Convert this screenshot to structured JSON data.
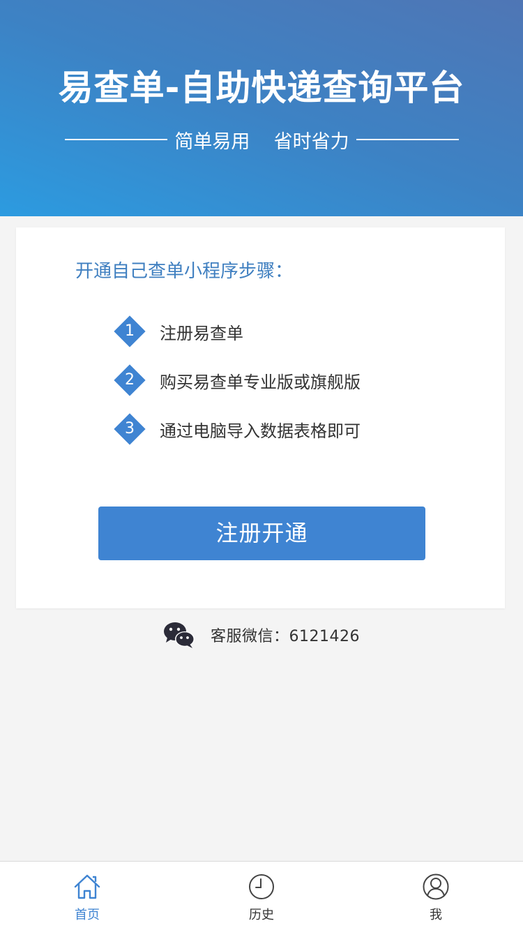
{
  "header": {
    "title": "易查单-自助快递查询平台",
    "subtitle": "简单易用    省时省力"
  },
  "card": {
    "heading": "开通自己查单小程序步骤：",
    "steps": [
      {
        "number": "1",
        "text": "注册易查单"
      },
      {
        "number": "2",
        "text": "购买易查单专业版或旗舰版"
      },
      {
        "number": "3",
        "text": "通过电脑导入数据表格即可"
      }
    ],
    "button_label": "注册开通"
  },
  "service": {
    "icon": "wechat-icon",
    "text": "客服微信：6121426"
  },
  "tabbar": {
    "items": [
      {
        "label": "首页",
        "icon": "home-icon",
        "active": true
      },
      {
        "label": "历史",
        "icon": "clock-icon",
        "active": false
      },
      {
        "label": "我",
        "icon": "user-icon",
        "active": false
      }
    ]
  },
  "colors": {
    "accent": "#3f84d2",
    "heading": "#3f7fc0",
    "background": "#f4f4f4"
  }
}
